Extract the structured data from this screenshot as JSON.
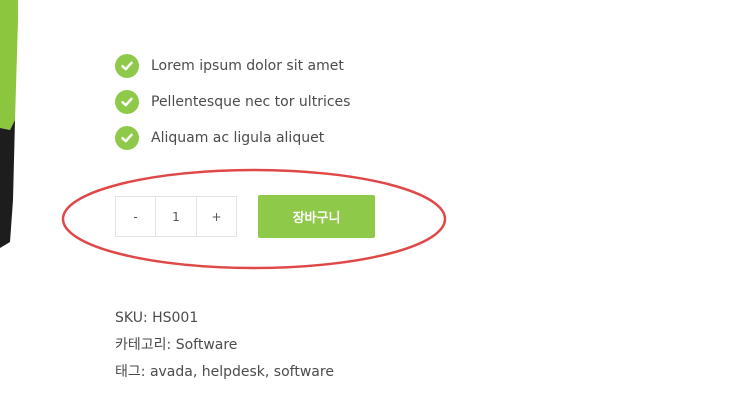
{
  "colors": {
    "accent": "#8fc94a",
    "annotation": "#e04848",
    "edge_green": "#8cc63f",
    "edge_dark": "#1d1d1d"
  },
  "features": [
    {
      "icon": "check-circle-icon",
      "text": "Lorem ipsum dolor sit amet"
    },
    {
      "icon": "check-circle-icon",
      "text": "Pellentesque nec tor ultrices"
    },
    {
      "icon": "check-circle-icon",
      "text": "Aliquam ac ligula aliquet"
    }
  ],
  "quantity": {
    "minus_label": "-",
    "value": "1",
    "plus_label": "+"
  },
  "cart": {
    "button_label": "장바구니"
  },
  "meta": {
    "sku_label": "SKU:",
    "sku_value": "HS001",
    "category_label": "카테고리:",
    "category_value": "Software",
    "tags_label": "태그:",
    "tags_value": "avada, helpdesk, software"
  }
}
